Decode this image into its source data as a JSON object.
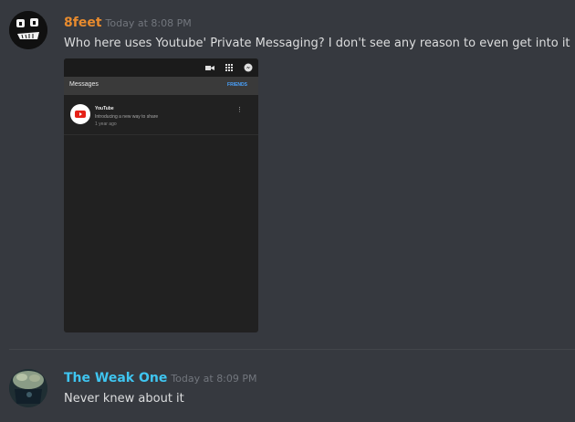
{
  "messages": [
    {
      "username": "8feet",
      "timestamp": "Today at 8:08 PM",
      "text": "Who here uses Youtube' Private Messaging? I don't see any reason to even get into it :p",
      "embed": {
        "header_title": "Messages",
        "tab_label": "FRIENDS",
        "item": {
          "name": "YouTube",
          "subtitle": "Introducing a new way to share",
          "time": "1 year ago",
          "more": "⋮"
        },
        "icons": [
          "video-camera-icon",
          "grid-icon",
          "messenger-icon"
        ]
      }
    },
    {
      "username": "The Weak One",
      "timestamp": "Today at 8:09 PM",
      "text": "Never knew about it"
    }
  ],
  "colors": {
    "background": "#36393f",
    "user1": "#e88b2e",
    "user2": "#3fc5f0"
  }
}
